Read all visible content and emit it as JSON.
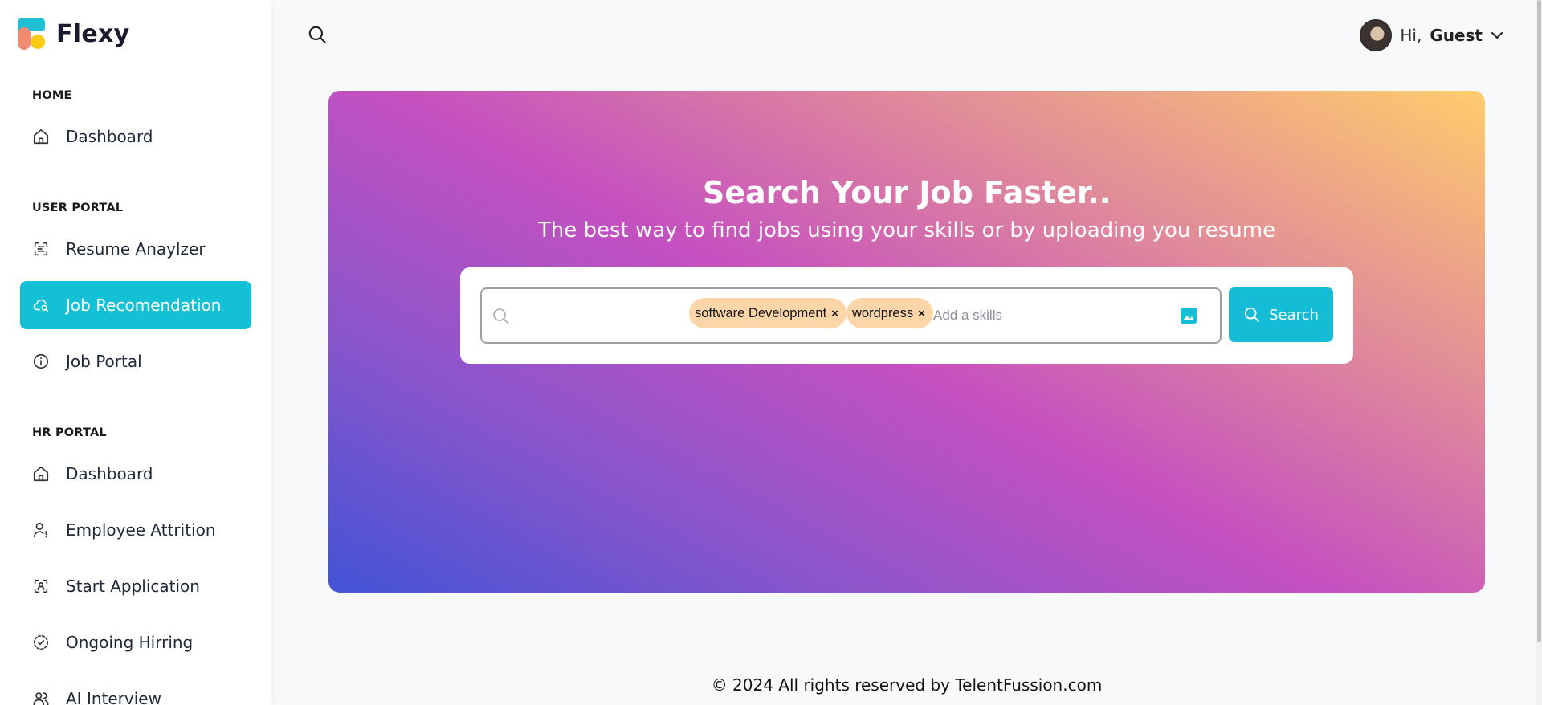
{
  "brand": {
    "name": "Flexy"
  },
  "sidebar": {
    "sections": [
      {
        "label": "HOME",
        "items": [
          {
            "label": "Dashboard",
            "icon": "home-icon"
          }
        ]
      },
      {
        "label": "USER PORTAL",
        "items": [
          {
            "label": "Resume Anaylzer",
            "icon": "scan-text-icon"
          },
          {
            "label": "Job Recomendation",
            "icon": "cloud-search-icon",
            "active": true
          },
          {
            "label": "Job Portal",
            "icon": "info-icon"
          }
        ]
      },
      {
        "label": "HR PORTAL",
        "items": [
          {
            "label": "Dashboard",
            "icon": "home-icon"
          },
          {
            "label": "Employee Attrition",
            "icon": "user-alert-icon"
          },
          {
            "label": "Start Application",
            "icon": "scan-user-icon"
          },
          {
            "label": "Ongoing Hirring",
            "icon": "circle-check-dashed-icon"
          },
          {
            "label": "AI Interview",
            "icon": "users-icon"
          }
        ]
      }
    ]
  },
  "header": {
    "greeting": "Hi,",
    "user_name": "Guest"
  },
  "hero": {
    "title": "Search Your Job Faster..",
    "subtitle": "The best way to find jobs using your skills or by uploading you resume",
    "chips": [
      "software Development",
      "wordpress"
    ],
    "chip_remove": "×",
    "input_placeholder": "Add a skills",
    "search_button": "Search"
  },
  "footer": {
    "text": "© 2024 All rights reserved by TelentFussion.com"
  },
  "colors": {
    "accent": "#14c0d6",
    "chip": "#fcd6a9"
  }
}
